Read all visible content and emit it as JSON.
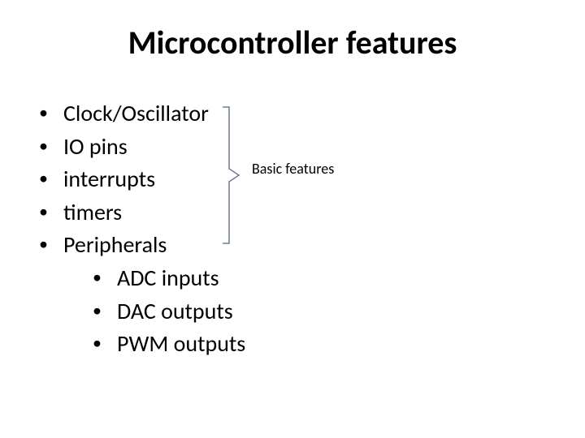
{
  "title": "Microcontroller features",
  "bullets": {
    "b0": "Clock/Oscillator",
    "b1": "IO pins",
    "b2": "interrupts",
    "b3": "timers",
    "b4": "Peripherals"
  },
  "subbullets": {
    "s0": "ADC inputs",
    "s1": "DAC outputs",
    "s2": "PWM outputs"
  },
  "annotation": "Basic features"
}
